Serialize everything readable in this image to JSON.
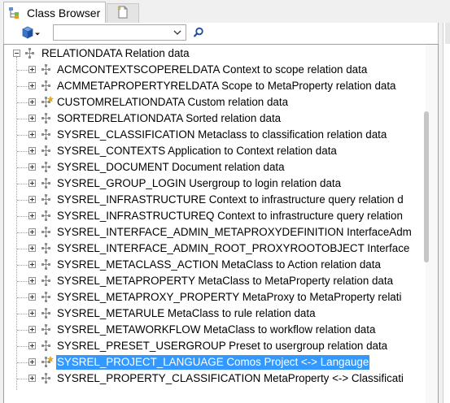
{
  "tabs": [
    {
      "label": "Class Browser",
      "icon": "class-browser-icon",
      "active": true
    },
    {
      "label": "",
      "icon": "new-document-icon",
      "active": false
    }
  ],
  "toolbar": {
    "cube_button_icon": "cube-icon",
    "dropdown_arrow_icon": "chevron-down-icon",
    "combo_value": "",
    "search_icon": "search-icon"
  },
  "tree": {
    "root": {
      "label": "RELATIONDATA Relation data",
      "icon": "class-icon",
      "expanded": true
    },
    "items": [
      {
        "label": "ACMCONTEXTSCOPERELDATA Context to scope relation data",
        "icon": "class-icon"
      },
      {
        "label": "ACMMETAPROPERTYRELDATA Scope to MetaProperty relation data",
        "icon": "class-icon"
      },
      {
        "label": "CUSTOMRELATIONDATA Custom relation data",
        "icon": "class-star-icon"
      },
      {
        "label": "SORTEDRELATIONDATA Sorted relation data",
        "icon": "class-icon"
      },
      {
        "label": "SYSREL_CLASSIFICATION Metaclass to classification relation data",
        "icon": "class-icon"
      },
      {
        "label": "SYSREL_CONTEXTS Application to Context relation data",
        "icon": "class-icon"
      },
      {
        "label": "SYSREL_DOCUMENT Document relation data",
        "icon": "class-icon"
      },
      {
        "label": "SYSREL_GROUP_LOGIN Usergroup to login relation data",
        "icon": "class-icon"
      },
      {
        "label": "SYSREL_INFRASTRUCTURE Context to infrastructure query relation d",
        "icon": "class-icon"
      },
      {
        "label": "SYSREL_INFRASTRUCTUREQ Context to infrastructure query relation",
        "icon": "class-icon"
      },
      {
        "label": "SYSREL_INTERFACE_ADMIN_METAPROXYDEFINITION InterfaceAdm",
        "icon": "class-icon"
      },
      {
        "label": "SYSREL_INTERFACE_ADMIN_ROOT_PROXYROOTOBJECT Interface",
        "icon": "class-icon"
      },
      {
        "label": "SYSREL_METACLASS_ACTION MetaClass to Action relation data",
        "icon": "class-icon"
      },
      {
        "label": "SYSREL_METAPROPERTY MetaClass to MetaProperty relation data",
        "icon": "class-icon"
      },
      {
        "label": "SYSREL_METAPROXY_PROPERTY MetaProxy to MetaProperty relati",
        "icon": "class-icon"
      },
      {
        "label": "SYSREL_METARULE MetaClass to rule relation data",
        "icon": "class-icon"
      },
      {
        "label": "SYSREL_METAWORKFLOW MetaClass to workflow relation data",
        "icon": "class-icon"
      },
      {
        "label": "SYSREL_PRESET_USERGROUP Preset to usergroup relation data",
        "icon": "class-icon"
      },
      {
        "label": "SYSREL_PROJECT_LANGUAGE Comos Project <-> Langauge",
        "icon": "class-star-icon",
        "selected": true
      },
      {
        "label": "SYSREL_PROPERTY_CLASSIFICATION MetaProperty <-> Classificati",
        "icon": "class-icon"
      }
    ]
  },
  "colors": {
    "selection": "#3399ff",
    "tree_line": "#a0a0a0",
    "star": "#f5b400"
  }
}
